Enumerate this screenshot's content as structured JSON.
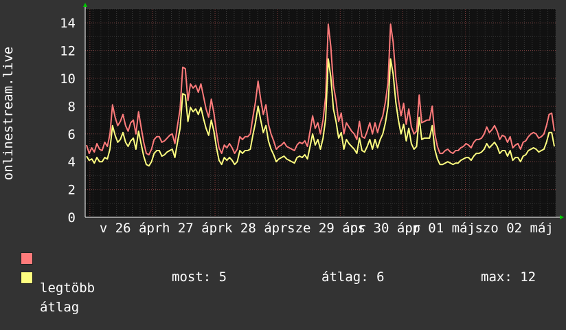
{
  "colors": {
    "background": "#333333",
    "plot_background": "#111111",
    "major_grid": "#7a3b3b",
    "minor_grid": "#3a3a3a",
    "axis_arrow": "#00cc00",
    "series_max": "#ff7b7b",
    "series_avg": "#ffff80",
    "text": "#ffffff"
  },
  "chart_data": {
    "type": "line",
    "title": "",
    "ylabel": "onlinestream.live",
    "ylim": [
      0,
      15
    ],
    "yticks": [
      0,
      2,
      4,
      6,
      8,
      10,
      12,
      14
    ],
    "xlim": [
      0,
      100
    ],
    "x_tick_labels": [
      {
        "pos": 1.0,
        "label": "v 26 ápr"
      },
      {
        "pos": 14.3,
        "label": "h 27 ápr"
      },
      {
        "pos": 27.6,
        "label": "k 28 ápr"
      },
      {
        "pos": 40.9,
        "label": "sze 29 ápr"
      },
      {
        "pos": 54.2,
        "label": "cs 30 ápr"
      },
      {
        "pos": 67.5,
        "label": "p 01 máj"
      },
      {
        "pos": 80.8,
        "label": "szo 02 máj"
      }
    ],
    "grid": true,
    "legend_placement": "bottom-left",
    "series": [
      {
        "name": "legtöbb",
        "color": "#ff7b7b",
        "values": [
          5.2,
          4.6,
          5.0,
          4.7,
          5.3,
          4.9,
          4.8,
          5.4,
          5.1,
          6.0,
          8.1,
          7.2,
          6.6,
          6.9,
          7.4,
          6.6,
          6.2,
          6.8,
          7.0,
          6.0,
          7.6,
          6.5,
          5.4,
          4.6,
          4.5,
          4.9,
          5.6,
          5.8,
          5.8,
          5.4,
          5.5,
          5.7,
          5.9,
          6.0,
          5.3,
          6.6,
          7.8,
          10.8,
          10.7,
          8.4,
          9.6,
          9.3,
          9.5,
          9.0,
          9.6,
          8.7,
          7.8,
          7.2,
          8.5,
          7.5,
          6.1,
          5.0,
          4.6,
          5.2,
          5.0,
          5.3,
          5.0,
          4.6,
          4.9,
          5.8,
          5.6,
          5.8,
          5.8,
          6.0,
          7.2,
          8.3,
          9.8,
          8.5,
          7.4,
          8.1,
          6.7,
          6.0,
          5.5,
          4.9,
          5.1,
          5.2,
          5.4,
          5.1,
          5.0,
          4.9,
          4.8,
          5.2,
          5.4,
          5.3,
          5.5,
          5.1,
          6.2,
          7.3,
          6.4,
          6.8,
          6.0,
          7.0,
          8.7,
          13.9,
          12.3,
          9.5,
          8.4,
          6.9,
          7.5,
          6.0,
          6.8,
          6.5,
          6.2,
          6.0,
          5.6,
          6.9,
          5.8,
          5.7,
          6.2,
          6.8,
          6.0,
          6.8,
          6.1,
          6.8,
          7.3,
          8.3,
          9.7,
          13.9,
          12.6,
          10.1,
          8.5,
          7.3,
          8.2,
          6.7,
          7.8,
          6.5,
          6.0,
          6.2,
          8.8,
          6.8,
          6.9,
          7.0,
          7.0,
          8.0,
          6.0,
          5.1,
          4.6,
          4.6,
          4.8,
          4.9,
          4.7,
          4.6,
          4.8,
          4.8,
          5.0,
          5.1,
          5.3,
          5.2,
          5.0,
          5.4,
          5.6,
          5.6,
          5.7,
          6.0,
          6.5,
          6.1,
          6.3,
          6.6,
          6.2,
          5.6,
          5.9,
          5.8,
          5.4,
          5.8,
          5.0,
          5.2,
          5.3,
          4.9,
          5.4,
          5.5,
          5.8,
          6.0,
          6.1,
          6.0,
          5.7,
          5.8,
          6.0,
          6.6,
          7.4,
          7.5,
          6.2
        ]
      },
      {
        "name": "átlag",
        "color": "#ffff80",
        "values": [
          4.4,
          4.1,
          4.2,
          3.9,
          4.3,
          4.0,
          4.0,
          4.3,
          4.2,
          4.9,
          6.6,
          5.9,
          5.4,
          5.6,
          6.1,
          5.4,
          5.1,
          5.5,
          5.7,
          4.9,
          6.2,
          5.3,
          4.4,
          3.8,
          3.7,
          4.0,
          4.6,
          4.8,
          4.8,
          4.4,
          4.5,
          4.7,
          4.8,
          4.9,
          4.3,
          5.4,
          6.4,
          8.9,
          8.8,
          6.9,
          7.9,
          7.6,
          7.8,
          7.4,
          7.9,
          7.1,
          6.4,
          5.9,
          7.0,
          6.2,
          5.0,
          4.1,
          3.8,
          4.3,
          4.1,
          4.3,
          4.1,
          3.8,
          4.0,
          4.8,
          4.6,
          4.8,
          4.8,
          4.9,
          5.9,
          6.8,
          8.0,
          7.0,
          6.1,
          6.6,
          5.5,
          4.9,
          4.5,
          4.0,
          4.2,
          4.3,
          4.4,
          4.2,
          4.1,
          4.0,
          3.9,
          4.3,
          4.4,
          4.3,
          4.5,
          4.2,
          5.1,
          6.0,
          5.2,
          5.6,
          4.9,
          5.7,
          7.1,
          11.4,
          10.1,
          7.8,
          6.9,
          5.7,
          6.1,
          4.9,
          5.6,
          5.3,
          5.1,
          4.9,
          4.6,
          5.7,
          4.8,
          4.7,
          5.1,
          5.6,
          4.9,
          5.6,
          5.0,
          5.6,
          6.0,
          6.8,
          8.0,
          11.4,
          10.3,
          8.3,
          7.0,
          6.0,
          6.7,
          5.5,
          6.4,
          5.3,
          4.9,
          5.1,
          7.2,
          5.6,
          5.7,
          5.7,
          5.7,
          6.6,
          4.9,
          4.2,
          3.8,
          3.8,
          3.9,
          4.0,
          3.9,
          3.8,
          3.9,
          3.9,
          4.1,
          4.2,
          4.3,
          4.3,
          4.1,
          4.4,
          4.6,
          4.6,
          4.7,
          4.9,
          5.3,
          5.0,
          5.2,
          5.4,
          5.1,
          4.6,
          4.8,
          4.8,
          4.4,
          4.8,
          4.1,
          4.3,
          4.3,
          4.0,
          4.4,
          4.5,
          4.8,
          4.9,
          5.0,
          4.9,
          4.7,
          4.8,
          4.9,
          5.4,
          6.1,
          6.1,
          5.1
        ]
      }
    ]
  },
  "legend": {
    "items": [
      {
        "label": "legtöbb",
        "color": "#ff7b7b"
      },
      {
        "label": "átlag",
        "color": "#ffff80"
      }
    ],
    "stats": {
      "now": "most: 5",
      "avg": "átlag: 6",
      "max": "max: 12"
    }
  }
}
